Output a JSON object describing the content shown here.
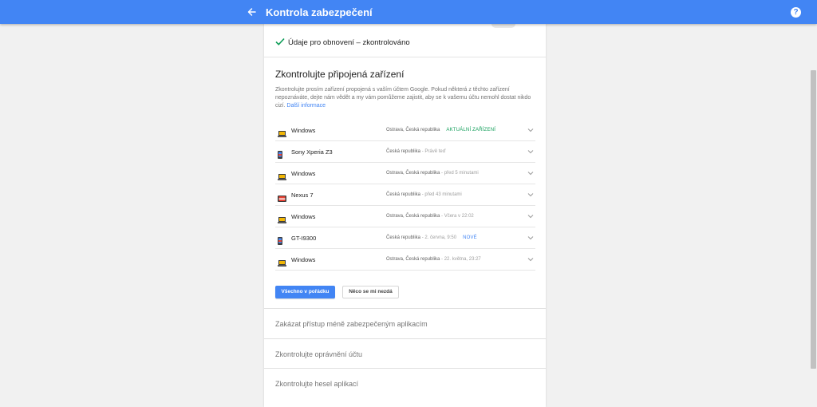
{
  "header": {
    "title": "Kontrola zabezpečení",
    "help_glyph": "?",
    "color": "#4285f4"
  },
  "recovery": {
    "text": "Údaje pro obnovení – zkontrolováno",
    "check_color": "#0f9d58"
  },
  "devices_section": {
    "title": "Zkontrolujte připojená zařízení",
    "description": "Zkontrolujte prosím zařízení propojená s vaším účtem Google. Pokud některá z těchto zařízení nepoznáváte, dejte nám vědět a my vám pomůžeme zajistit, aby se k vašemu účtu nemohl dostat nikdo cizí.",
    "more_link": "Další informace",
    "devices": [
      {
        "name": "Windows",
        "icon": "laptop-icon",
        "location": "Ostrava, Česká republika",
        "sep": "",
        "time": "",
        "badge": "AKTUÁLNÍ ZAŘÍZENÍ",
        "badge_type": "current"
      },
      {
        "name": "Sony Xperia Z3",
        "icon": "phone-icon",
        "location": "Česká republika",
        "sep": " - ",
        "time": "Právě teď",
        "badge": "",
        "badge_type": ""
      },
      {
        "name": "Windows",
        "icon": "laptop-icon",
        "location": "Ostrava, Česká republika",
        "sep": " - ",
        "time": "před 5 minutami",
        "badge": "",
        "badge_type": ""
      },
      {
        "name": "Nexus 7",
        "icon": "tablet-icon",
        "location": "Česká republika",
        "sep": " - ",
        "time": "před 43 minutami",
        "badge": "",
        "badge_type": ""
      },
      {
        "name": "Windows",
        "icon": "laptop-icon",
        "location": "Ostrava, Česká republika",
        "sep": " - ",
        "time": "Včera v 22:02",
        "badge": "",
        "badge_type": ""
      },
      {
        "name": "GT-I9300",
        "icon": "phone-icon",
        "location": "Česká republika",
        "sep": " - ",
        "time": "2. června, 9:50",
        "badge": "NOVÉ",
        "badge_type": "new"
      },
      {
        "name": "Windows",
        "icon": "laptop-icon",
        "location": "Ostrava, Česká republika",
        "sep": " - ",
        "time": "22. května, 23:27",
        "badge": "",
        "badge_type": ""
      }
    ],
    "ok_button": "Všechno v pořádku",
    "wrong_button": "Něco se mi nezdá"
  },
  "collapsed_sections": [
    "Zakázat přístup méně zabezpečeným aplikacím",
    "Zkontrolujte oprávnění účtu",
    "Zkontrolujte hesel aplikací"
  ]
}
